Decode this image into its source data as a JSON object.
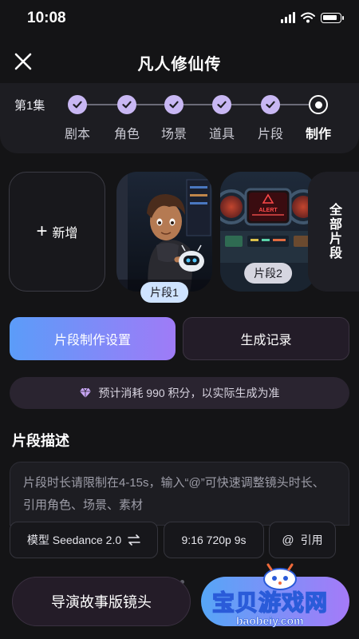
{
  "status_bar": {
    "time": "10:08"
  },
  "header": {
    "title": "凡人修仙传"
  },
  "progress": {
    "episode": "第1集",
    "steps": [
      {
        "label": "剧本",
        "state": "done"
      },
      {
        "label": "角色",
        "state": "done"
      },
      {
        "label": "场景",
        "state": "done"
      },
      {
        "label": "道具",
        "state": "done"
      },
      {
        "label": "片段",
        "state": "done"
      },
      {
        "label": "制作",
        "state": "current"
      }
    ]
  },
  "segments": {
    "add_label": "新增",
    "items": [
      {
        "label": "片段1"
      },
      {
        "label": "片段2"
      }
    ],
    "thumb2_sign": "ALERT",
    "all_label": "全部片段"
  },
  "tabs": {
    "primary": "片段制作设置",
    "secondary": "生成记录"
  },
  "cost_notice": "预计消耗 990 积分，以实际生成为准",
  "section": {
    "title": "片段描述",
    "placeholder": "片段时长请限制在4-15s，输入“@”可快速调整镜头时长、引用角色、场景、素材"
  },
  "options": {
    "model": "模型 Seedance 2.0",
    "format": "9:16 720p 9s",
    "reference": "引用"
  },
  "bottom": {
    "storyboard_button": "导演故事版镜头"
  },
  "watermark": {
    "text": "宝贝游戏网",
    "url": "baobeiy.com"
  },
  "colors": {
    "background": "#141416",
    "step_done": "#c8b7f3",
    "gradient_start": "#5b9cf9",
    "gradient_end": "#9f7bf7"
  }
}
